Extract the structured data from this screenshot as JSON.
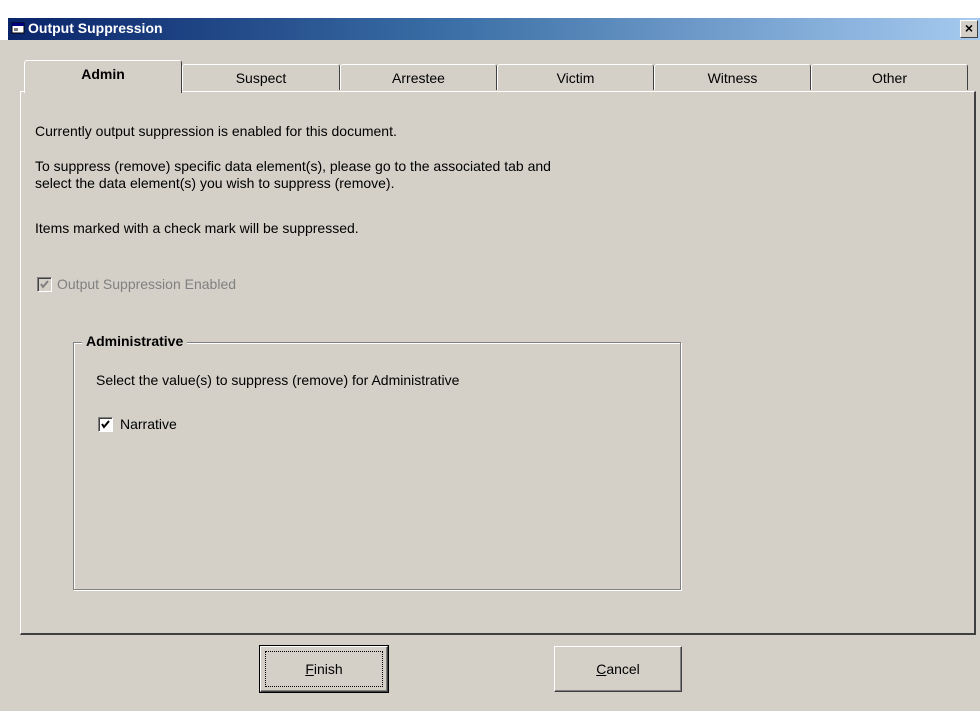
{
  "window": {
    "title": "Output Suppression",
    "close_glyph": "×"
  },
  "tabs": [
    {
      "label": "Admin",
      "active": true
    },
    {
      "label": "Suspect",
      "active": false
    },
    {
      "label": "Arrestee",
      "active": false
    },
    {
      "label": "Victim",
      "active": false
    },
    {
      "label": "Witness",
      "active": false
    },
    {
      "label": "Other",
      "active": false
    }
  ],
  "admin": {
    "status_text": "Currently output suppression is enabled for this document.",
    "instruction_line1": "To suppress (remove) specific data element(s), please go to the associated tab and",
    "instruction_line2": "select the data element(s) you wish to suppress (remove).",
    "note_text": "Items marked with a check mark will be suppressed.",
    "enabled_checkbox_label": "Output Suppression Enabled",
    "enabled_checked": true,
    "group": {
      "title": "Administrative",
      "prompt": "Select the value(s) to suppress (remove) for Administrative",
      "items": [
        {
          "label": "Narrative",
          "checked": true
        }
      ]
    }
  },
  "buttons": {
    "finish": {
      "mnemonic": "F",
      "rest": "inish"
    },
    "cancel": {
      "mnemonic": "C",
      "rest": "ancel"
    }
  },
  "icons": {
    "window": "app-window-icon",
    "close": "close-icon",
    "check": "checkmark-icon"
  }
}
